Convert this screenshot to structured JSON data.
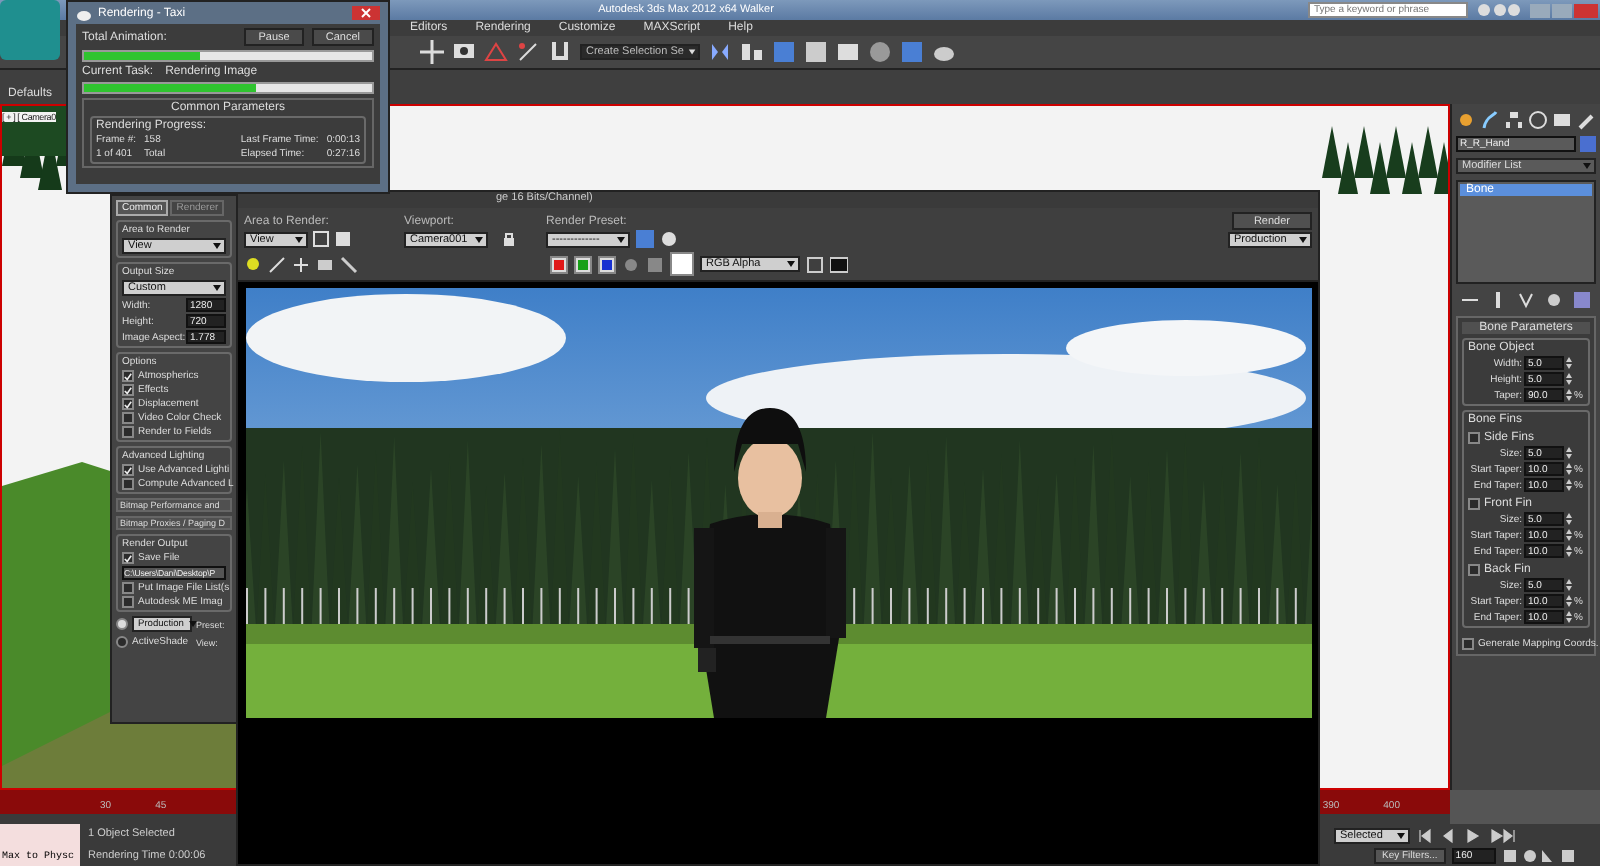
{
  "app_window": {
    "title": "Autodesk 3ds Max 2012 x64      Walker",
    "search": {
      "placeholder": "Type a keyword or phrase"
    }
  },
  "menu": [
    "Editors",
    "Rendering",
    "Customize",
    "MAXScript",
    "Help"
  ],
  "toolbar": {
    "selection_set": "Create Selection Se"
  },
  "ribbon": {
    "preset": "Defaults"
  },
  "viewport": {
    "label": "[ + ] [ Camera0"
  },
  "command_panel": {
    "object_name": "R_R_Hand",
    "modifier_list": "Modifier List",
    "stack": [
      {
        "label": "Bone",
        "selected": true
      }
    ],
    "rollout": "Bone Parameters",
    "bone_object": {
      "title": "Bone Object",
      "fields": [
        {
          "label": "Width:",
          "value": "5.0"
        },
        {
          "label": "Height:",
          "value": "5.0"
        },
        {
          "label": "Taper:",
          "value": "90.0",
          "unit": "%"
        }
      ]
    },
    "bone_fins": {
      "title": "Bone Fins",
      "fins": [
        {
          "label": "Side Fins",
          "checked": false,
          "fields": [
            {
              "label": "Size:",
              "value": "5.0"
            },
            {
              "label": "Start Taper:",
              "value": "10.0",
              "unit": "%"
            },
            {
              "label": "End Taper:",
              "value": "10.0",
              "unit": "%"
            }
          ]
        },
        {
          "label": "Front Fin",
          "checked": false,
          "fields": [
            {
              "label": "Size:",
              "value": "5.0"
            },
            {
              "label": "Start Taper:",
              "value": "10.0",
              "unit": "%"
            },
            {
              "label": "End Taper:",
              "value": "10.0",
              "unit": "%"
            }
          ]
        },
        {
          "label": "Back Fin",
          "checked": false,
          "fields": [
            {
              "label": "Size:",
              "value": "5.0"
            },
            {
              "label": "Start Taper:",
              "value": "10.0",
              "unit": "%"
            },
            {
              "label": "End Taper:",
              "value": "10.0",
              "unit": "%"
            }
          ]
        }
      ]
    },
    "mapping": {
      "label": "Generate Mapping Coords.",
      "checked": false
    }
  },
  "timeline": {
    "left_ticks": [
      "30",
      "45"
    ],
    "right_ticks": [
      "390",
      "400"
    ]
  },
  "status": {
    "script_field": "Max to Physc",
    "selection": "1 Object Selected",
    "render_time": "Rendering Time  0:00:06",
    "key_mode": "Selected",
    "key_filters": "Key Filters...",
    "frame": "160"
  },
  "render_progress": {
    "title": "Rendering - Taxi",
    "buttons": [
      "Pause",
      "Cancel"
    ],
    "total": {
      "label": "Total Animation:",
      "level": 0.4
    },
    "current": {
      "label": "Current Task:",
      "task": "Rendering Image",
      "level": 0.6
    },
    "rollout": "Common Parameters",
    "group": "Rendering Progress:",
    "stats": [
      {
        "label": "Frame #:",
        "value": "158"
      },
      {
        "label": "Last Frame Time:",
        "value": "0:00:13"
      },
      {
        "label": "1 of 401",
        "value": "Total"
      },
      {
        "label": "Elapsed Time:",
        "value": "0:27:16"
      }
    ]
  },
  "render_setup": {
    "tabs": [
      {
        "label": "Common",
        "selected": true
      },
      {
        "label": "Renderer",
        "selected": false
      }
    ],
    "area": {
      "title": "Area to Render",
      "value": "View"
    },
    "output_size": {
      "title": "Output Size",
      "preset": "Custom",
      "fields": [
        {
          "label": "Width:",
          "value": "1280"
        },
        {
          "label": "Height:",
          "value": "720"
        },
        {
          "label": "Image Aspect:",
          "value": "1.778"
        }
      ]
    },
    "options": {
      "title": "Options",
      "items": [
        {
          "label": "Atmospherics",
          "checked": true
        },
        {
          "label": "Effects",
          "checked": true
        },
        {
          "label": "Displacement",
          "checked": true
        },
        {
          "label": "Video Color Check",
          "checked": false
        },
        {
          "label": "Render to Fields",
          "checked": false
        }
      ]
    },
    "advanced_lighting": {
      "title": "Advanced Lighting",
      "items": [
        {
          "label": "Use Advanced Lighti",
          "checked": true
        },
        {
          "label": "Compute Advanced L",
          "checked": false
        }
      ]
    },
    "rollouts": [
      "Bitmap Performance and",
      "Bitmap Proxies / Paging D"
    ],
    "render_output": {
      "title": "Render Output",
      "save_file": {
        "label": "Save File",
        "checked": true
      },
      "path": "C:\\Users\\Dani\\Desktop\\P",
      "items": [
        {
          "label": "Put Image File List(s",
          "checked": false
        },
        {
          "label": "Autodesk ME Imag",
          "checked": false
        }
      ]
    },
    "modes": [
      {
        "label": "Production",
        "kind": "dropdown",
        "selected": true,
        "extra": "Preset:"
      },
      {
        "label": "ActiveShade",
        "kind": "text",
        "selected": false,
        "extra": "View:"
      }
    ]
  },
  "render_frame": {
    "title": "ge 16 Bits/Channel)",
    "area_label": "Area to Render:",
    "area": "View",
    "viewport_label": "Viewport:",
    "viewport": "Camera001",
    "preset_label": "Render Preset:",
    "preset": "-------------",
    "render_button": "Render",
    "mode": "Production",
    "channels": [
      {
        "color": "#e01818",
        "on": true
      },
      {
        "color": "#18a018",
        "on": true
      },
      {
        "color": "#1830d0",
        "on": true
      }
    ],
    "display": "RGB Alpha"
  }
}
